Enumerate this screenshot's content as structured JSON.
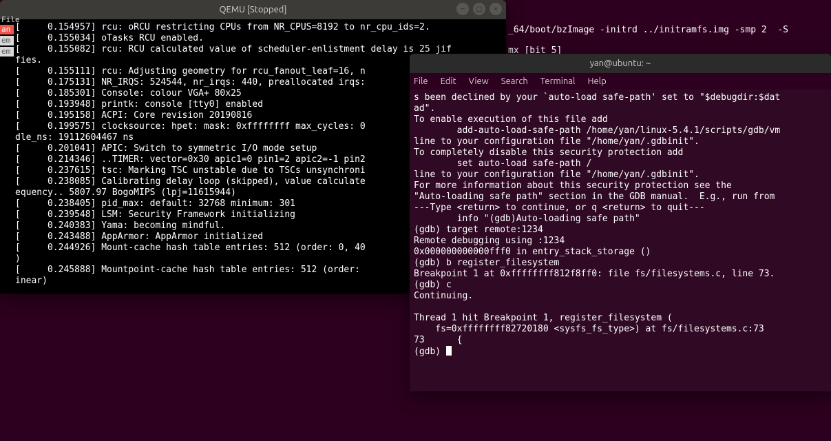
{
  "background": {
    "line1": "_64/boot/bzImage -initrd ../initramfs.img -smp 2  -S",
    "line2": "mx [bit 5]"
  },
  "qemu": {
    "title": "QEMU [Stopped]",
    "side_menu": "File",
    "side_badge_a": "an",
    "side_badge_b1": "em",
    "side_badge_b2": "em",
    "body": "[     0.154957] rcu: oRCU restricting CPUs from NR_CPUS=8192 to nr_cpu_ids=2.\n[     0.155034] oTasks RCU enabled.\n[     0.155082] rcu: RCU calculated value of scheduler-enlistment delay is 25 jif\nfies.\n[     0.155111] rcu: Adjusting geometry for rcu_fanout_leaf=16, n\n[     0.175131] NR_IRQS: 524544, nr_irqs: 440, preallocated irqs:\n[     0.185301] Console: colour VGA+ 80x25\n[     0.193948] printk: console [tty0] enabled\n[     0.195158] ACPI: Core revision 20190816\n[     0.199575] clocksource: hpet: mask: 0xffffffff max_cycles: 0\ndle_ns: 19112604467 ns\n[     0.201041] APIC: Switch to symmetric I/O mode setup\n[     0.214346] ..TIMER: vector=0x30 apic1=0 pin1=2 apic2=-1 pin2\n[     0.237615] tsc: Marking TSC unstable due to TSCs unsynchroni\n[     0.238085] Calibrating delay loop (skipped), value calculate\nequency.. 5807.97 BogoMIPS (lpj=11615944)\n[     0.238405] pid_max: default: 32768 minimum: 301\n[     0.239548] LSM: Security Framework initializing\n[     0.240383] Yama: becoming mindful.\n[     0.243488] AppArmor: AppArmor initialized\n[     0.244926] Mount-cache hash table entries: 512 (order: 0, 40\n)\n[     0.245888] Mountpoint-cache hash table entries: 512 (order:\ninear)\n"
  },
  "gnome": {
    "title": "yan@ubuntu: ~",
    "menu": {
      "file": "File",
      "edit": "Edit",
      "view": "View",
      "search": "Search",
      "terminal": "Terminal",
      "help": "Help"
    },
    "body": "s been declined by your `auto-load safe-path' set to \"$debugdir:$dat\nad\".\nTo enable execution of this file add\n        add-auto-load-safe-path /home/yan/linux-5.4.1/scripts/gdb/vm\nline to your configuration file \"/home/yan/.gdbinit\".\nTo completely disable this security protection add\n        set auto-load safe-path /\nline to your configuration file \"/home/yan/.gdbinit\".\nFor more information about this security protection see the\n\"Auto-loading safe path\" section in the GDB manual.  E.g., run from \n---Type <return> to continue, or q <return> to quit---\n        info \"(gdb)Auto-loading safe path\"\n(gdb) target remote:1234\nRemote debugging using :1234\n0x000000000000fff0 in entry_stack_storage ()\n(gdb) b register_filesystem\nBreakpoint 1 at 0xffffffff812f8ff0: file fs/filesystems.c, line 73.\n(gdb) c\nContinuing.\n\nThread 1 hit Breakpoint 1, register_filesystem (\n    fs=0xffffffff82720180 <sysfs_fs_type>) at fs/filesystems.c:73\n73      {\n(gdb) "
  }
}
